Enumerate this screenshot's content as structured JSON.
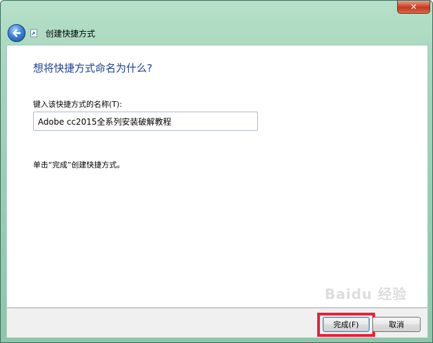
{
  "window": {
    "close_symbol": "✕"
  },
  "nav": {
    "back_symbol": "←",
    "title": "创建快捷方式"
  },
  "content": {
    "heading": "想将快捷方式命名为什么?",
    "field_label": "键入该快捷方式的名称(T):",
    "name_value": "Adobe cc2015全系列安装破解教程",
    "hint": "单击“完成”创建快捷方式。"
  },
  "footer": {
    "finish_label": "完成(F)",
    "cancel_label": "取消"
  },
  "watermark": {
    "text": "Baidu 经验"
  },
  "colors": {
    "heading": "#1b3f91",
    "highlight": "#e8203a"
  }
}
